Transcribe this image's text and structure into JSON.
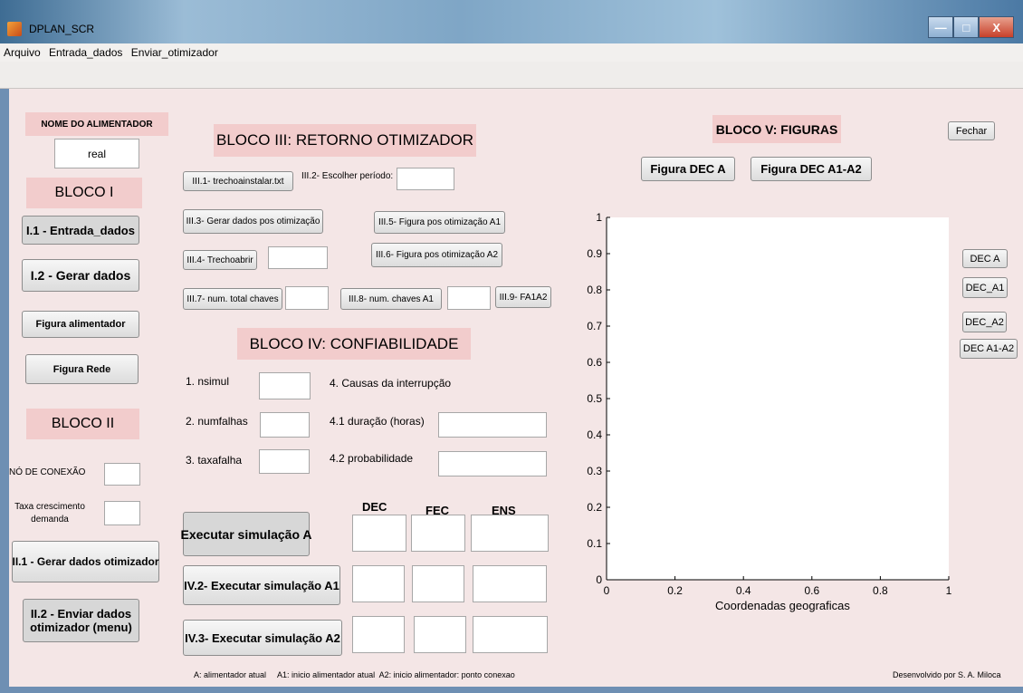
{
  "window": {
    "title": "DPLAN_SCR",
    "min_glyph": "—",
    "max_glyph": "□",
    "close_glyph": "X"
  },
  "menu": {
    "items": [
      "Arquivo",
      "Entrada_dados",
      "Enviar_otimizador"
    ]
  },
  "bloco1": {
    "nome_label": "NOME DO ALIMENTADOR",
    "nome_value": "real",
    "title": "BLOCO I",
    "entrada_btn": "I.1 - Entrada_dados",
    "gerar_btn": "I.2 - Gerar dados",
    "fig_alim_btn": "Figura alimentador",
    "fig_rede_btn": "Figura Rede"
  },
  "bloco2": {
    "title": "BLOCO II",
    "no_conexao_label": "NÓ DE CONEXÃO",
    "taxa_label_1": "Taxa crescimento",
    "taxa_label_2": "demanda",
    "gerar_otim_btn": "II.1 - Gerar dados otimizador",
    "enviar_btn_1": "II.2 - Enviar dados",
    "enviar_btn_2": "otimizador (menu)"
  },
  "bloco3": {
    "title": "BLOCO III: RETORNO OTIMIZADOR",
    "trecho_btn": "III.1- trechoainstalar.txt",
    "periodo_label": "III.2- Escolher período:",
    "gerar_pos_btn": "III.3- Gerar dados pos otimização",
    "fig_a1_btn": "III.5- Figura pos otimização A1",
    "trechoabrir_btn": "III.4- Trechoabrir",
    "fig_a2_btn": "III.6- Figura pos otimização A2",
    "num_total_btn": "III.7- num. total chaves",
    "num_a1_btn": "III.8- num. chaves A1",
    "fa1a2_btn": "III.9- FA1A2"
  },
  "bloco4": {
    "title": "BLOCO IV: CONFIABILIDADE",
    "nsimul_label": "1. nsimul",
    "numfalhas_label": "2. numfalhas",
    "taxafalha_label": "3. taxafalha",
    "causas_label": "4. Causas da interrupção",
    "duracao_label": "4.1 duração (horas)",
    "prob_label": "4.2 probabilidade",
    "col_dec": "DEC",
    "col_fec": "FEC",
    "col_ens": "ENS",
    "sim_a_btn": "Executar simulação A",
    "sim_a1_btn": "IV.2- Executar simulação A1",
    "sim_a2_btn": "IV.3- Executar simulação A2",
    "legend": "A: alimentador atual     A1: inicio alimentador atual  A2: inicio alimentador: ponto conexao"
  },
  "bloco5": {
    "title": "BLOCO V: FIGURAS",
    "fechar_btn": "Fechar",
    "fig_dec_a_btn": "Figura DEC A",
    "fig_dec_a1a2_btn": "Figura DEC A1-A2",
    "dec_a_btn": "DEC A",
    "dec_a1_btn": "DEC_A1",
    "dec_a2_btn": "DEC_A2",
    "dec_a1a2_btn": "DEC A1-A2",
    "credits": "Desenvolvido por S. A. Miloca"
  },
  "chart_data": {
    "type": "line",
    "xlabel": "Coordenadas geograficas",
    "ylabel": "",
    "title": "",
    "xlim": [
      0,
      1
    ],
    "ylim": [
      0,
      1
    ],
    "xticks": [
      "0",
      "0.2",
      "0.4",
      "0.6",
      "0.8",
      "1"
    ],
    "yticks": [
      "0",
      "0.1",
      "0.2",
      "0.3",
      "0.4",
      "0.5",
      "0.6",
      "0.7",
      "0.8",
      "0.9",
      "1"
    ],
    "series": []
  }
}
